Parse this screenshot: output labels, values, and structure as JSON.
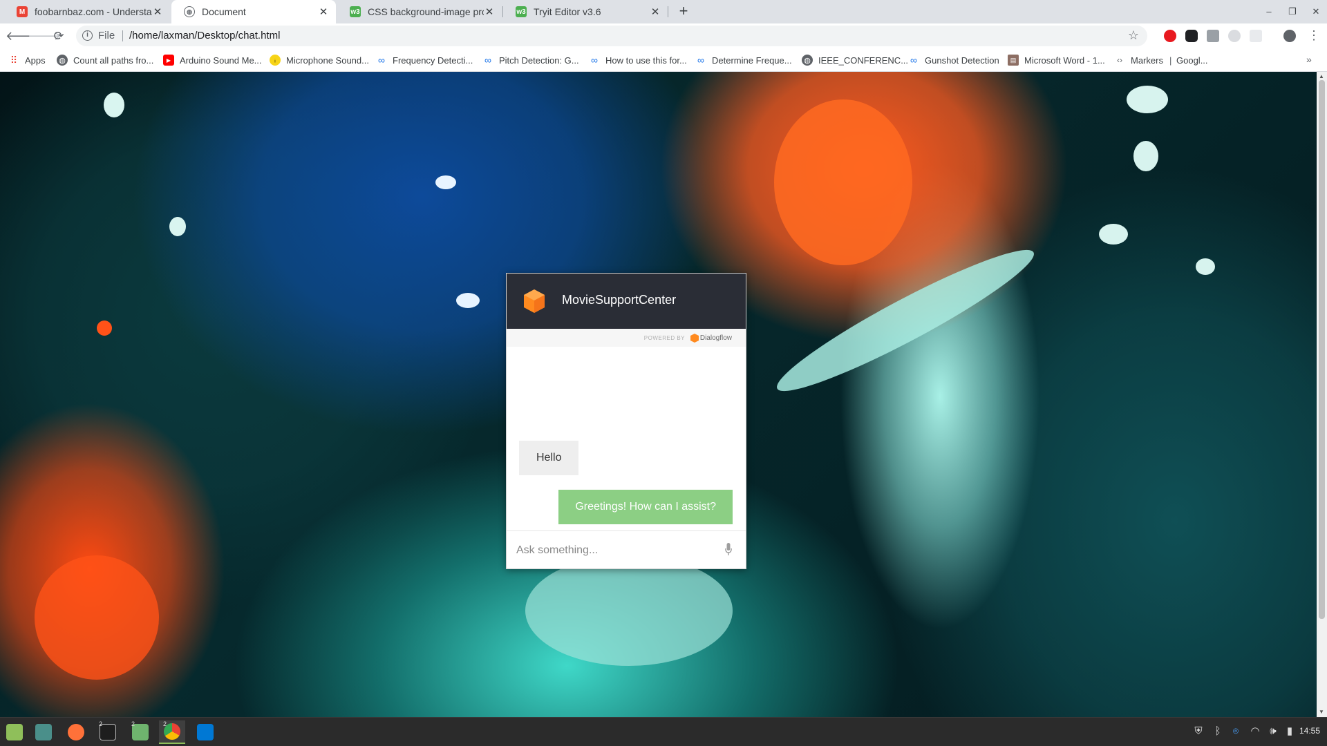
{
  "browser": {
    "tabs": [
      {
        "title": "foobarnbaz.com - Understandi",
        "active": false,
        "favicon": "gmail-icon"
      },
      {
        "title": "Document",
        "active": true,
        "favicon": "globe-icon"
      },
      {
        "title": "CSS background-image proper",
        "active": false,
        "favicon": "w3schools-icon"
      },
      {
        "title": "Tryit Editor v3.6",
        "active": false,
        "favicon": "w3schools-icon"
      }
    ],
    "new_tab": "+",
    "window_controls": {
      "minimize": "–",
      "restore": "❐",
      "close": "✕"
    }
  },
  "toolbar": {
    "scheme": "File",
    "url": "/home/laxman/Desktop/chat.html"
  },
  "bookmarks": [
    {
      "label": "Apps",
      "icon": "apps-grid-icon"
    },
    {
      "label": "Count all paths fro...",
      "icon": "globe-icon"
    },
    {
      "label": "Arduino Sound Me...",
      "icon": "youtube-icon"
    },
    {
      "label": "Microphone Sound...",
      "icon": "instructables-icon"
    },
    {
      "label": "Frequency Detecti...",
      "icon": "link-icon"
    },
    {
      "label": "Pitch Detection: G...",
      "icon": "link-icon"
    },
    {
      "label": "How to use this for...",
      "icon": "link-icon"
    },
    {
      "label": "Determine Freque...",
      "icon": "link-icon"
    },
    {
      "label": "IEEE_CONFERENC...",
      "icon": "globe-icon"
    },
    {
      "label": "Gunshot Detection",
      "icon": "link-icon"
    },
    {
      "label": "Microsoft Word - 1...",
      "icon": "document-icon"
    },
    {
      "label": "Markers",
      "icon": "code-icon"
    },
    {
      "label": "Googl...",
      "icon": "none"
    }
  ],
  "chat": {
    "title": "MovieSupportCenter",
    "powered_by": "POWERED BY",
    "powered_brand": "Dialogflow",
    "messages": [
      {
        "from": "user",
        "text": "Hello"
      },
      {
        "from": "bot",
        "text": "Greetings! How can I assist?"
      }
    ],
    "input_placeholder": "Ask something...",
    "colors": {
      "header": "#2a2d36",
      "bot_bubble": "#8ccf84",
      "user_bubble": "#eeeeee",
      "logo": "#ff8a1f"
    }
  },
  "taskbar": {
    "apps": [
      {
        "name": "mint-menu-icon"
      },
      {
        "name": "show-desktop-icon"
      },
      {
        "name": "firefox-icon"
      },
      {
        "name": "terminal-icon",
        "count": "2"
      },
      {
        "name": "files-icon",
        "count": "2"
      },
      {
        "name": "chrome-icon",
        "count": "2"
      },
      {
        "name": "vscode-icon"
      }
    ],
    "clock": "14:55"
  }
}
